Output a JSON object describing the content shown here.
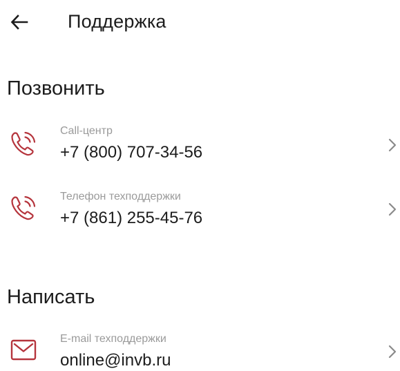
{
  "header": {
    "back_icon": "arrow-left-icon",
    "title": "Поддержка"
  },
  "sections": [
    {
      "title": "Позвонить",
      "items": [
        {
          "icon": "phone-call-icon",
          "caption": "Call-центр",
          "value": "+7 (800) 707-34-56",
          "chevron": "chevron-right-icon"
        },
        {
          "icon": "phone-call-icon",
          "caption": "Телефон техподдержки",
          "value": "+7 (861) 255-45-76",
          "chevron": "chevron-right-icon"
        }
      ]
    },
    {
      "title": "Написать",
      "items": [
        {
          "icon": "mail-icon",
          "caption": "E-mail техподдержки",
          "value": "online@invb.ru",
          "chevron": "chevron-right-icon"
        }
      ]
    }
  ],
  "colors": {
    "accent_icon": "#b5343c",
    "text_primary": "#1c1c1c",
    "text_secondary": "#9a9a9a",
    "chevron": "#8a8a8a"
  }
}
